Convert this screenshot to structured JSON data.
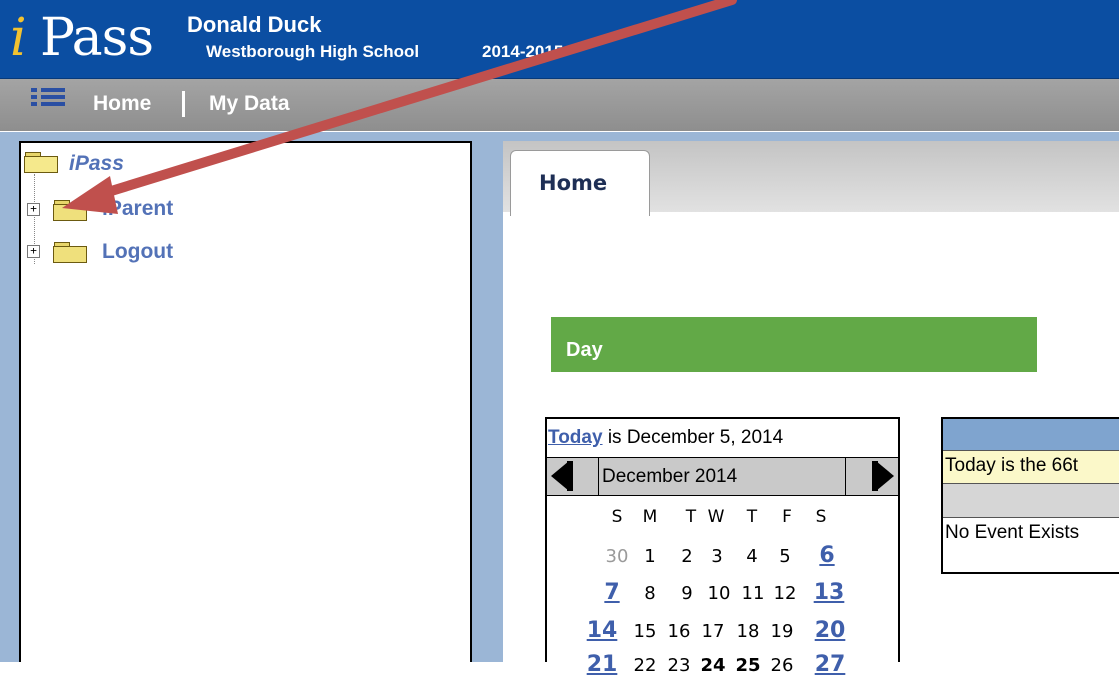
{
  "header": {
    "logo_i": "i",
    "logo_rest": "Pass",
    "user_name": "Donald Duck",
    "school": "Westborough High School",
    "year": "2014-2015",
    "bg_color": "#0b4ea2"
  },
  "nav": {
    "menu_icon": "list-menu-icon",
    "home": "Home",
    "my_data": "My Data"
  },
  "tree": {
    "root": "iPass",
    "items": [
      {
        "label": "iParent",
        "icon": "folder-icon",
        "expander": "+"
      },
      {
        "label": "Logout",
        "icon": "folder-icon",
        "expander": "+"
      }
    ]
  },
  "tabs": {
    "active": "Home"
  },
  "day_banner": {
    "label": "Day",
    "color": "#62a947"
  },
  "calendar": {
    "today_link": "Today",
    "today_text": " is December 5, 2014",
    "month": "December 2014",
    "days_of_week": [
      "S",
      "M",
      "T",
      "W",
      "T",
      "F",
      "S"
    ],
    "weeks": [
      [
        "30",
        "1",
        "2",
        "3",
        "4",
        "5",
        "6"
      ],
      [
        "7",
        "8",
        "9",
        "10",
        "11",
        "12",
        "13"
      ],
      [
        "14",
        "15",
        "16",
        "17",
        "18",
        "19",
        "20"
      ],
      [
        "21",
        "22",
        "23",
        "24",
        "25",
        "26",
        "27"
      ]
    ]
  },
  "events": {
    "today_info": "Today is the 66t",
    "no_events": "No Event Exists"
  },
  "annotation": {
    "arrow_color": "#c0504d"
  }
}
